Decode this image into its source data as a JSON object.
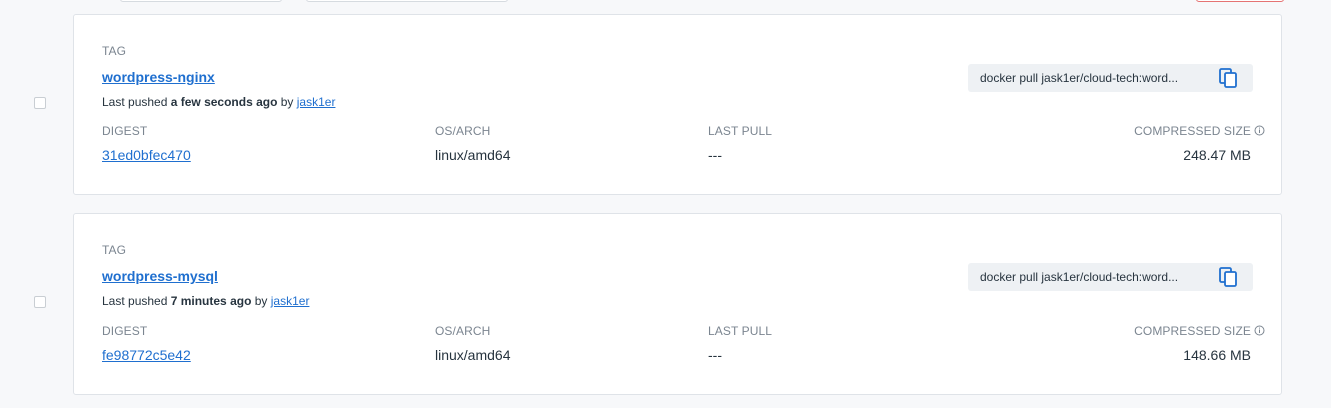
{
  "columns": {
    "tag": "TAG",
    "digest": "DIGEST",
    "os_arch": "OS/ARCH",
    "last_pull": "LAST PULL",
    "compressed_size": "COMPRESSED SIZE"
  },
  "icons": {
    "copy": "copy-icon",
    "info": "info-icon"
  },
  "colors": {
    "link": "#1f6fcf",
    "card_bg": "#ffffff",
    "page_bg": "#f7f8fa"
  },
  "tags": [
    {
      "name": "wordpress-nginx",
      "pushed_prefix": "Last pushed ",
      "pushed_time": "a few seconds ago",
      "pushed_by": " by ",
      "user": "jask1er",
      "pull_command": "docker pull jask1er/cloud-tech:word...",
      "digest": "31ed0bfec470",
      "os_arch": "linux/amd64",
      "last_pull": "---",
      "size": "248.47 MB"
    },
    {
      "name": "wordpress-mysql",
      "pushed_prefix": "Last pushed ",
      "pushed_time": "7 minutes ago",
      "pushed_by": " by ",
      "user": "jask1er",
      "pull_command": "docker pull jask1er/cloud-tech:word...",
      "digest": "fe98772c5e42",
      "os_arch": "linux/amd64",
      "last_pull": "---",
      "size": "148.66 MB"
    }
  ]
}
